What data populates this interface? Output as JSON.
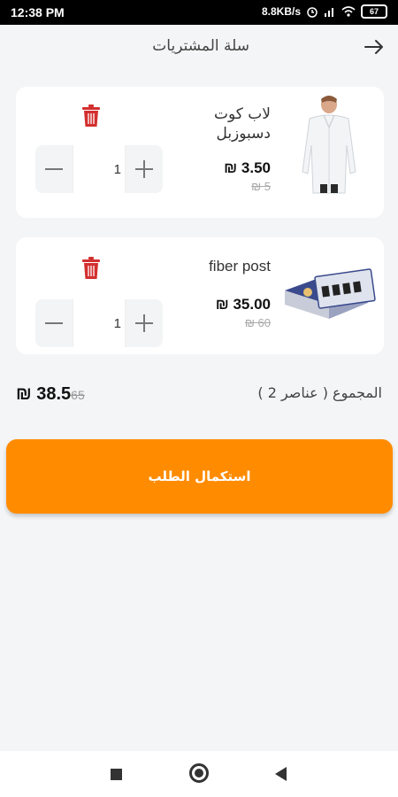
{
  "status_bar": {
    "time": "12:38 PM",
    "network_speed": "8.8KB/s",
    "battery": "67"
  },
  "header": {
    "title": "سلة المشتريات",
    "back_icon": "arrow-right-icon"
  },
  "cart": {
    "items": [
      {
        "name": "لاب كوت دسبوزبل",
        "price": "₪ 3.50",
        "old_price": "₪ 5",
        "quantity": "1",
        "image_icon": "lab-coat-image"
      },
      {
        "name": "fiber post",
        "price": "₪ 35.00",
        "old_price": "₪ 60",
        "quantity": "1",
        "image_icon": "fiber-post-box-image"
      }
    ]
  },
  "summary": {
    "label": "المجموع ( عناصر 2 )",
    "total": "₪ 38.5",
    "old_total": "65"
  },
  "checkout": {
    "label": "استكمال الطلب",
    "color": "#ff8c00"
  },
  "colors": {
    "accent": "#ff8c00",
    "delete": "#d32f2f"
  }
}
